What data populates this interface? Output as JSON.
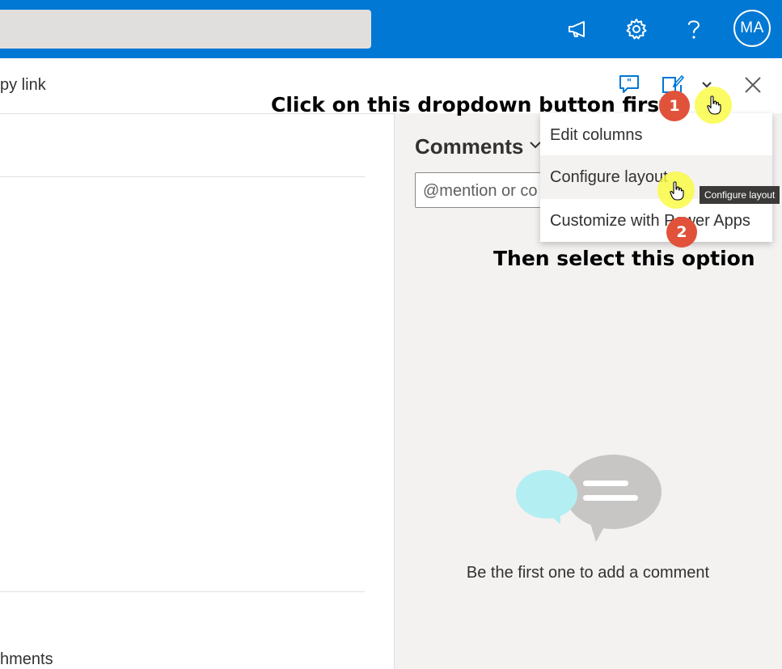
{
  "header": {
    "search_value": "",
    "icons": [
      "megaphone-icon",
      "gear-icon",
      "help-icon"
    ],
    "avatar_initials": "MA",
    "colors": {
      "suite_bar": "#0078d4",
      "search_box": "#e1dfdd"
    }
  },
  "command_bar": {
    "copy_link_label": "py link",
    "icons": [
      "comment-icon",
      "edit-form-icon",
      "chevron-down-icon",
      "close-icon"
    ]
  },
  "form": {
    "attachments_label": "hments"
  },
  "comments": {
    "title": "Comments",
    "input_placeholder": "@mention or co",
    "empty_message": "Be the first one to add a comment",
    "colors": {
      "pane_bg": "#f3f2f1",
      "bubble_left": "#b3eef2",
      "bubble_right": "#c8c6c4"
    }
  },
  "dropdown_menu": {
    "items": [
      {
        "label": "Edit columns"
      },
      {
        "label": "Configure layout",
        "hovered": true
      },
      {
        "label": "Customize with Power Apps"
      }
    ]
  },
  "tooltip": {
    "text": "Configure layout"
  },
  "annotations": {
    "step1_text": "Click on this dropdown button first",
    "step1_number": "1",
    "step2_text": "Then select this option",
    "step2_number": "2",
    "colors": {
      "badge": "#e0523a",
      "click_highlight": "#fafa3c"
    }
  }
}
